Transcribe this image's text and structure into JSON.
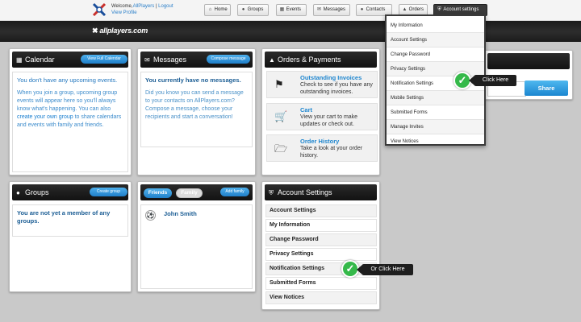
{
  "header": {
    "welcome_prefix": "Welcome,",
    "username": "AllPlayers",
    "separator": "|",
    "logout": "Logout",
    "view_profile": "View Profile",
    "brand": "allplayers.com",
    "nav": [
      {
        "label": "Home",
        "icon": "home-icon"
      },
      {
        "label": "Groups",
        "icon": "groups-icon"
      },
      {
        "label": "Events",
        "icon": "calendar-icon"
      },
      {
        "label": "Messages",
        "icon": "envelope-icon"
      },
      {
        "label": "Contacts",
        "icon": "contacts-icon"
      },
      {
        "label": "Orders",
        "icon": "cart-icon"
      },
      {
        "label": "Account settings",
        "icon": "shield-icon"
      }
    ]
  },
  "calendar": {
    "title": "Calendar",
    "button": "View Full Calendar",
    "empty": "You don't have any upcoming events.",
    "text_before": "When you join a group, upcoming group events will appear here so you'll always know what's happening. You can also ",
    "link": "create your own group",
    "text_after": " to share calendars and events with family and friends."
  },
  "messages": {
    "title": "Messages",
    "button": "Compose message",
    "empty": "You currently have no messages.",
    "text": "Did you know you can send a message to your contacts on AllPlayers.com? Compose a message, choose your recipients and start a conversation!"
  },
  "orders": {
    "title": "Orders & Payments",
    "items": [
      {
        "title": "Outstanding Invoices",
        "desc": "Check to see if you have any outstanding invoices.",
        "icon": "flag-icon"
      },
      {
        "title": "Cart",
        "desc": "View your cart to make updates or check out.",
        "icon": "cart-icon"
      },
      {
        "title": "Order History",
        "desc": "Take a look at your order history.",
        "icon": "folder-icon"
      }
    ]
  },
  "groups": {
    "title": "Groups",
    "button": "Create group",
    "empty": "You are not yet a member of any groups."
  },
  "friends": {
    "tab_friends": "Friends",
    "tab_family": "Family",
    "button": "Add family",
    "person": "John Smith"
  },
  "account": {
    "title": "Account Settings",
    "items": [
      "Account Settings",
      "My Information",
      "Change Password",
      "Privacy Settings",
      "Notification Settings",
      "Submitted Forms",
      "View Notices"
    ]
  },
  "dropdown": {
    "items": [
      "My Information",
      "Account Settings",
      "Change Password",
      "Privacy Settings",
      "Notification Settings",
      "Mobile Settings",
      "Submitted Forms",
      "Manage Invites",
      "View Notices"
    ]
  },
  "share": {
    "button": "Share"
  },
  "callouts": {
    "click_here": "Click Here",
    "or_click_here": "Or Click Here"
  },
  "colors": {
    "accent": "#1f80c9",
    "callout_green": "#35b94a",
    "header_dark": "#1e1e1e"
  }
}
